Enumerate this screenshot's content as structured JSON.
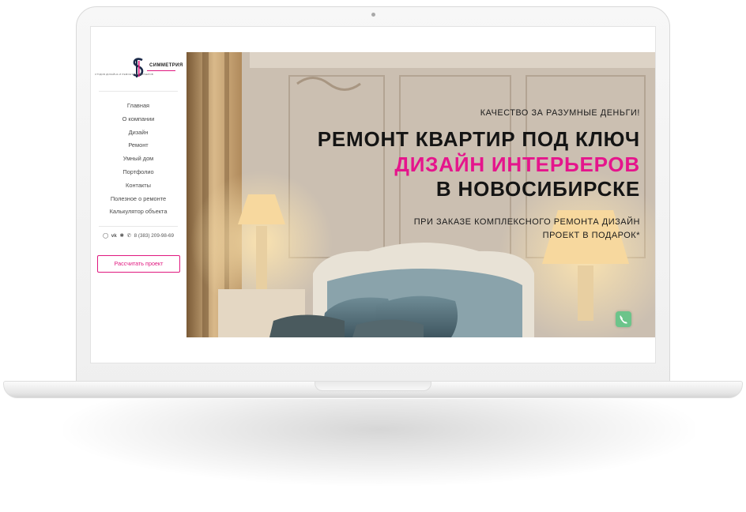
{
  "site": {
    "logo_name": "СИММЕТРИЯ",
    "logo_subtitle": "СТУДИЯ ДИЗАЙНА И РЕМОНТА ИНТЕРЬЕРОВ",
    "brand_color": "#e0187f"
  },
  "sidebar": {
    "menu": [
      {
        "label": "Главная"
      },
      {
        "label": "О компании"
      },
      {
        "label": "Дизайн"
      },
      {
        "label": "Ремонт"
      },
      {
        "label": "Умный дом"
      },
      {
        "label": "Портфолио"
      },
      {
        "label": "Контакты"
      },
      {
        "label": "Полезное о ремонте"
      },
      {
        "label": "Калькулятор объекта"
      }
    ],
    "social_icons": [
      "instagram-icon",
      "vk-icon",
      "odnoklassniki-icon",
      "phone-icon"
    ],
    "phone": "8 (383) 209-98-69",
    "cta_label": "Рассчитать проект"
  },
  "hero": {
    "tagline": "КАЧЕСТВО ЗА РАЗУМНЫЕ ДЕНЬГИ!",
    "headline_1": "РЕМОНТ КВАРТИР ПОД КЛЮЧ",
    "headline_2": "ДИЗАЙН ИНТЕРЬЕРОВ",
    "headline_3": "В НОВОСИБИРСКЕ",
    "promo": "ПРИ ЗАКАЗЕ КОМПЛЕКСНОГО РЕМОНТА ДИЗАЙН ПРОЕКТ В ПОДАРОК*",
    "accent_color": "#e5158c",
    "call_button_icon": "phone-icon",
    "call_button_color": "#6cc48a"
  }
}
